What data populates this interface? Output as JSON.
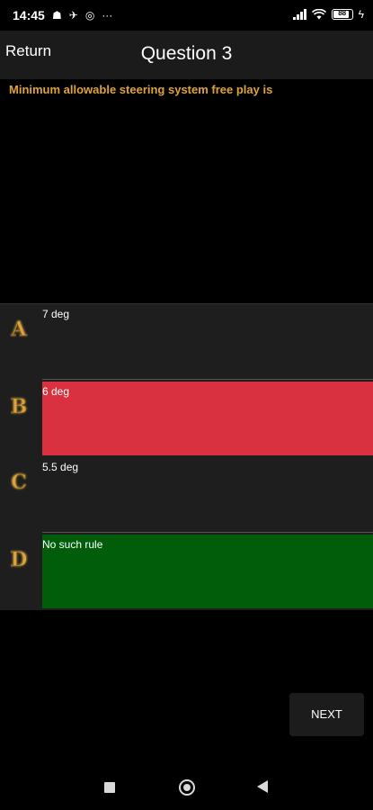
{
  "status_bar": {
    "time": "14:45",
    "battery": "88",
    "more": "···"
  },
  "header": {
    "return_label": "Return",
    "title": "Question 3"
  },
  "question": {
    "text": "Minimum allowable steering system free play is"
  },
  "answers": [
    {
      "letter": "A",
      "text": "7 deg",
      "state": "neutral"
    },
    {
      "letter": "B",
      "text": "6 deg",
      "state": "wrong"
    },
    {
      "letter": "C",
      "text": "5.5 deg",
      "state": "neutral"
    },
    {
      "letter": "D",
      "text": "No such rule",
      "state": "correct"
    }
  ],
  "next_label": "NEXT",
  "colors": {
    "question_text": "#e0a33a",
    "wrong": "#d93140",
    "correct": "#025d0a",
    "letter_gold": "#d9a441"
  }
}
